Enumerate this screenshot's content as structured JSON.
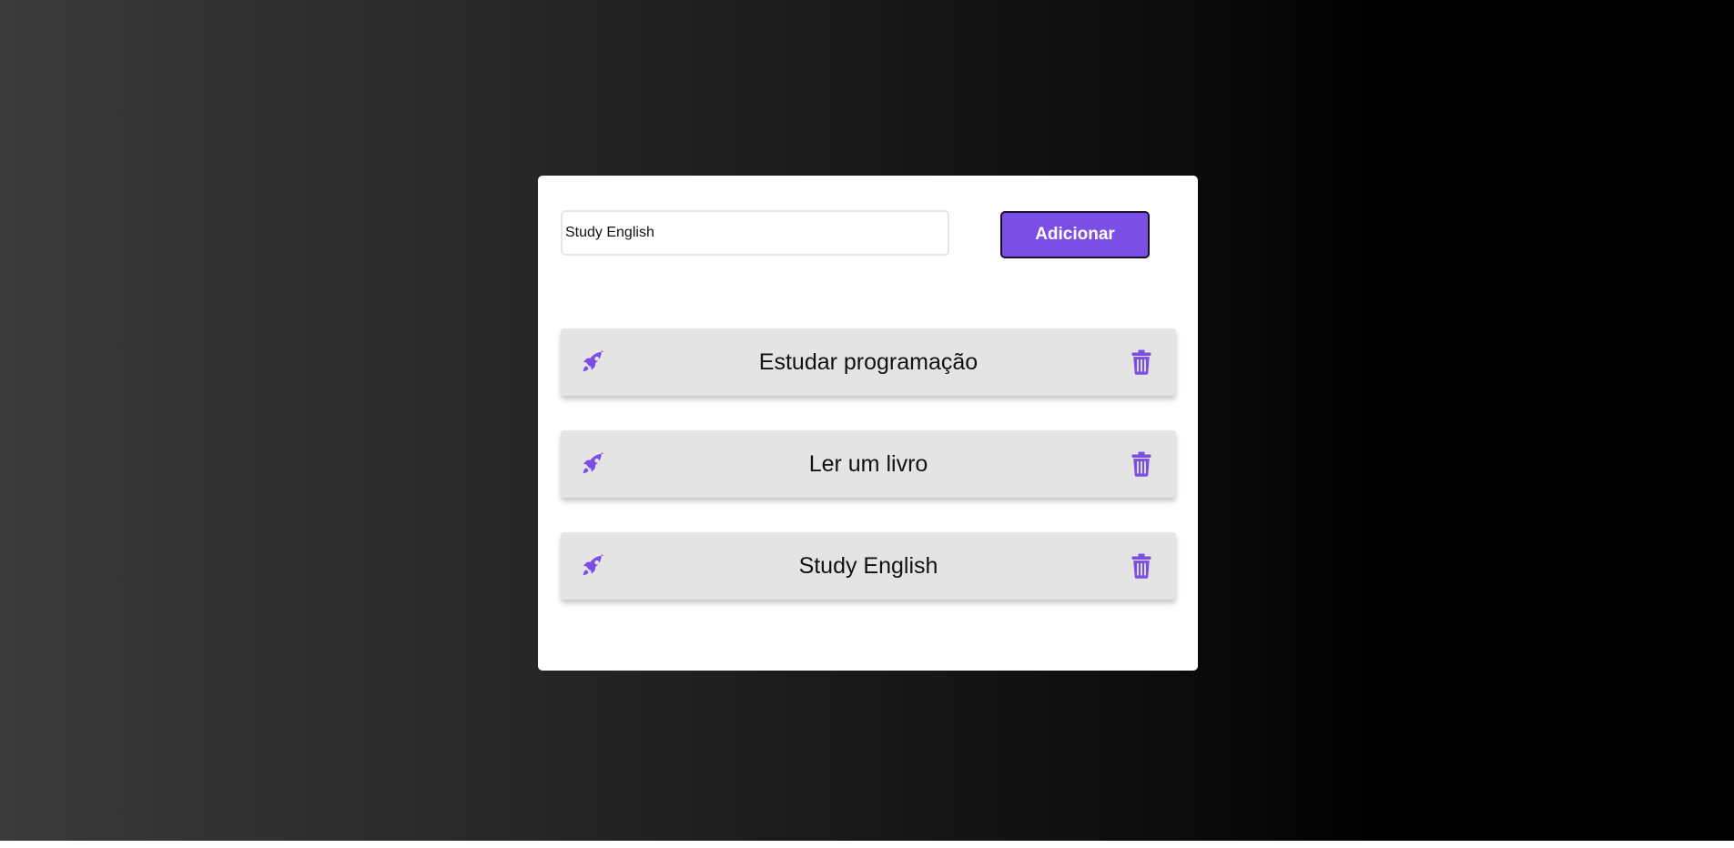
{
  "form": {
    "input_value": "Study English",
    "add_button_label": "Adicionar"
  },
  "tasks": [
    {
      "label": "Estudar programação",
      "icon": "rocket-icon",
      "action_icon": "trash-icon"
    },
    {
      "label": "Ler um livro",
      "icon": "rocket-icon",
      "action_icon": "trash-icon"
    },
    {
      "label": "Study English",
      "icon": "rocket-icon",
      "action_icon": "trash-icon"
    }
  ],
  "colors": {
    "accent": "#7b4fe6",
    "item_background": "#e4e4e4",
    "card_background": "#ffffff"
  }
}
